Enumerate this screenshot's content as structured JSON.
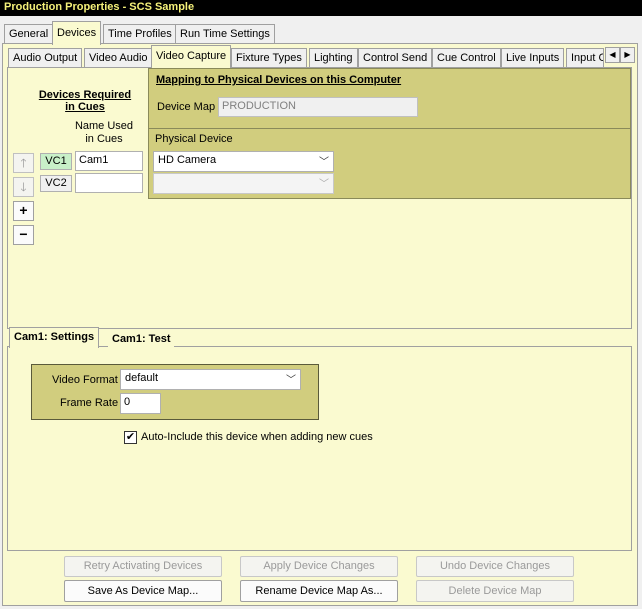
{
  "window": {
    "title": "Production Properties - SCS Sample"
  },
  "main_tabs": [
    "General",
    "Devices",
    "Time Profiles",
    "Run Time Settings"
  ],
  "sub_tabs": [
    "Audio Output",
    "Video Audio",
    "Video Capture",
    "Fixture Types",
    "Lighting",
    "Control Send",
    "Cue Control",
    "Live Inputs",
    "Input G"
  ],
  "left_panel": {
    "title_line1": "Devices Required",
    "title_line2": "in Cues",
    "col_header_line1": "Name Used",
    "col_header_line2": "in Cues",
    "rows": [
      {
        "code": "VC1",
        "name": "Cam1"
      },
      {
        "code": "VC2",
        "name": ""
      }
    ],
    "add_glyph": "+",
    "remove_glyph": "−"
  },
  "mapping": {
    "title": "Mapping to Physical Devices on this Computer",
    "device_map_label": "Device Map",
    "device_map_value": "PRODUCTION",
    "physical_device_header": "Physical Device",
    "devices": [
      "HD Camera",
      ""
    ]
  },
  "settings_tabs": [
    "Cam1: Settings",
    "Cam1: Test"
  ],
  "settings": {
    "video_format_label": "Video Format",
    "video_format_value": "default",
    "frame_rate_label": "Frame Rate",
    "frame_rate_value": "0",
    "auto_include_label": "Auto-Include this device when adding new cues",
    "auto_include_checked": true
  },
  "footer_buttons": {
    "retry": "Retry Activating Devices",
    "apply": "Apply Device Changes",
    "undo": "Undo Device Changes",
    "save_as": "Save As Device Map...",
    "rename": "Rename Device Map As...",
    "delete": "Delete Device Map"
  },
  "colors": {
    "title_text": "#f5f17a",
    "panel_yellow": "#fafad0",
    "mapping_olive": "#d1cd7e",
    "code_green": "#c8f0c8"
  }
}
